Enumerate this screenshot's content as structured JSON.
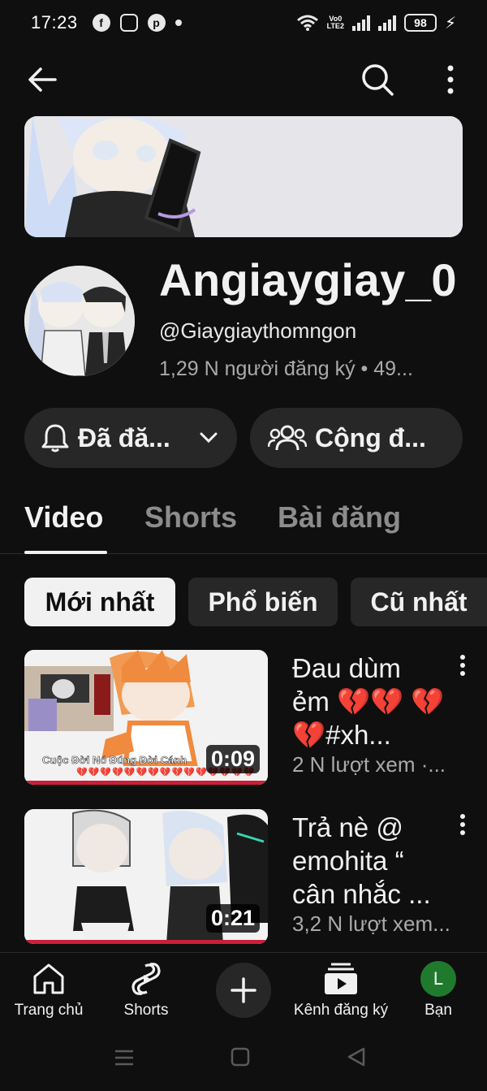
{
  "status_bar": {
    "time": "17:23",
    "volte_line1": "Vo0",
    "volte_line2": "LTE2",
    "battery": "98",
    "app_icons": [
      "facebook-icon",
      "instagram-icon",
      "pinterest-icon"
    ]
  },
  "channel": {
    "name": "Angiaygiay_0",
    "handle": "@Giaygiaythomngon",
    "meta": "1,29 N người đăng ký • 49..."
  },
  "buttons": {
    "subscribed_label": "Đã đă...",
    "community_label": "Cộng đ..."
  },
  "tabs": [
    {
      "label": "Video",
      "active": true
    },
    {
      "label": "Shorts",
      "active": false
    },
    {
      "label": "Bài đăng",
      "active": false
    }
  ],
  "chips": [
    {
      "label": "Mới nhất",
      "active": true
    },
    {
      "label": "Phổ biến",
      "active": false
    },
    {
      "label": "Cũ nhất",
      "active": false
    }
  ],
  "videos": [
    {
      "title": "Đau dùm ẻm 💔💔 💔💔#xh...",
      "meta": "2 N lượt xem ·...",
      "duration": "0:09",
      "thumb_caption": "Cuộc Đời Nó Đúng Đời Cánh"
    },
    {
      "title": "Trả nè @ emohita “ cân nhắc ...",
      "meta": "3,2 N lượt xem...",
      "duration": "0:21"
    }
  ],
  "bottom_nav": [
    {
      "label": "Trang chủ",
      "icon": "home-icon"
    },
    {
      "label": "Shorts",
      "icon": "shorts-icon"
    },
    {
      "label": "",
      "icon": "create-icon"
    },
    {
      "label": "Kênh đăng ký",
      "icon": "subscriptions-icon"
    },
    {
      "label": "Bạn",
      "icon": "avatar",
      "avatar_letter": "L"
    }
  ],
  "colors": {
    "background": "#0f0f0f",
    "surface": "#272727",
    "text": "#f1f1f1",
    "muted": "#aaaaaa",
    "progress": "#cc1e3a",
    "avatar_green": "#1f7a2e"
  }
}
